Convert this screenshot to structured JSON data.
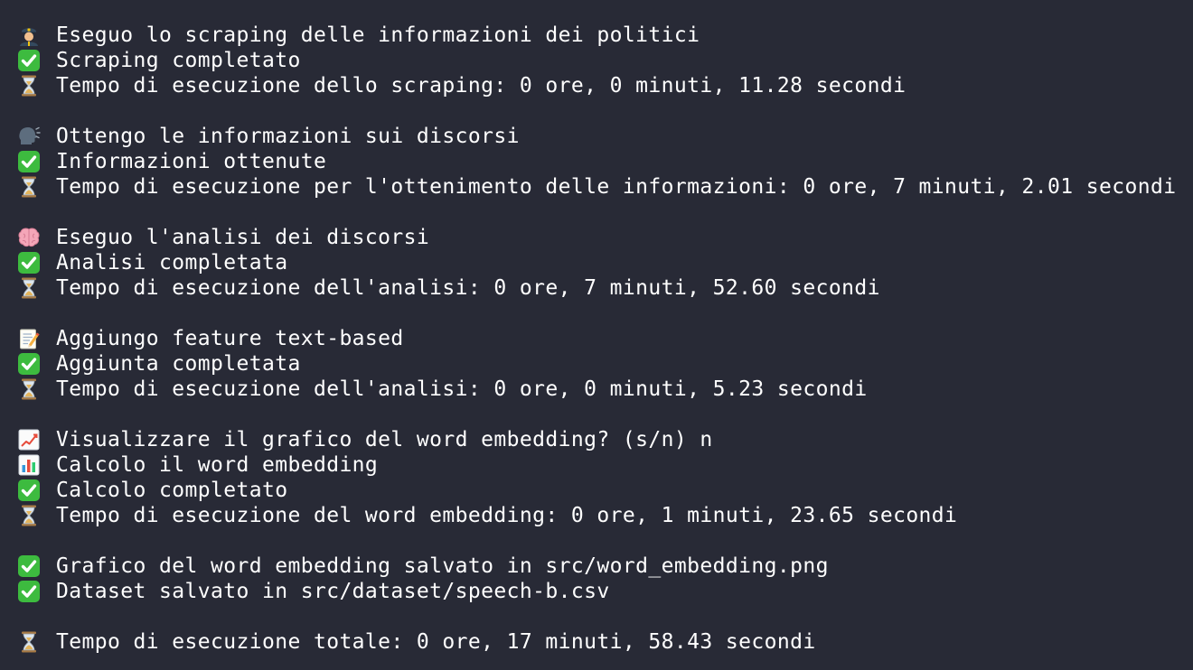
{
  "window": {
    "background": "#282a36",
    "text_color": "#ffffff"
  },
  "lines": [
    {
      "icon": "police-officer-icon",
      "text": "Eseguo lo scraping delle informazioni dei politici"
    },
    {
      "icon": "check-mark-icon",
      "text": "Scraping completato"
    },
    {
      "icon": "hourglass-icon",
      "text": "Tempo di esecuzione dello scraping: 0 ore, 0 minuti, 11.28 secondi"
    },
    {
      "blank": true
    },
    {
      "icon": "speaking-head-icon",
      "text": "Ottengo le informazioni sui discorsi"
    },
    {
      "icon": "check-mark-icon",
      "text": "Informazioni ottenute"
    },
    {
      "icon": "hourglass-icon",
      "text": "Tempo di esecuzione per l'ottenimento delle informazioni: 0 ore, 7 minuti, 2.01 secondi"
    },
    {
      "blank": true
    },
    {
      "icon": "brain-icon",
      "text": "Eseguo l'analisi dei discorsi"
    },
    {
      "icon": "check-mark-icon",
      "text": "Analisi completata"
    },
    {
      "icon": "hourglass-icon",
      "text": "Tempo di esecuzione dell'analisi: 0 ore, 7 minuti, 52.60 secondi"
    },
    {
      "blank": true
    },
    {
      "icon": "memo-icon",
      "text": "Aggiungo feature text-based"
    },
    {
      "icon": "check-mark-icon",
      "text": "Aggiunta completata"
    },
    {
      "icon": "hourglass-icon",
      "text": "Tempo di esecuzione dell'analisi: 0 ore, 0 minuti, 5.23 secondi"
    },
    {
      "blank": true
    },
    {
      "icon": "chart-increasing-icon",
      "text": "Visualizzare il grafico del word embedding? (s/n) n"
    },
    {
      "icon": "bar-chart-icon",
      "text": "Calcolo il word embedding"
    },
    {
      "icon": "check-mark-icon",
      "text": "Calcolo completato"
    },
    {
      "icon": "hourglass-icon",
      "text": "Tempo di esecuzione del word embedding: 0 ore, 1 minuti, 23.65 secondi"
    },
    {
      "blank": true
    },
    {
      "icon": "check-mark-icon",
      "text": "Grafico del word embedding salvato in src/word_embedding.png"
    },
    {
      "icon": "check-mark-icon",
      "text": "Dataset salvato in src/dataset/speech-b.csv"
    },
    {
      "blank": true
    },
    {
      "icon": "hourglass-icon",
      "text": "Tempo di esecuzione totale: 0 ore, 17 minuti, 58.43 secondi"
    }
  ]
}
